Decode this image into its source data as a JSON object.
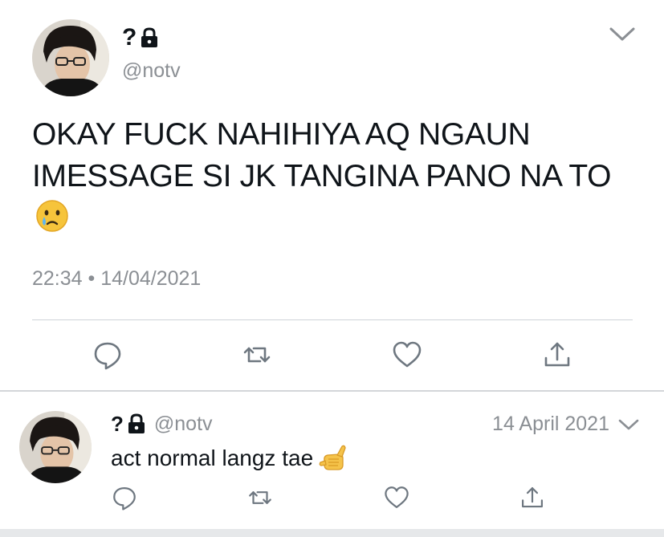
{
  "tweet": {
    "name": "?",
    "handle": "@notv",
    "text": "OKAY FUCK NAHIHIYA AQ NGAUN IMESSAGE SI JK TANGINA PANO NA TO",
    "text_emoji": "crying-face-emoji",
    "meta": "22:34 • 14/04/2021",
    "actions": [
      "reply-icon",
      "retweet-icon",
      "like-icon",
      "share-icon"
    ]
  },
  "reply": {
    "name": "?",
    "handle": "@notv",
    "date": "14 April 2021",
    "text": "act normal langz tae",
    "text_emoji": "call-me-hand-emoji",
    "actions": [
      "reply-icon",
      "retweet-icon",
      "like-icon",
      "share-icon"
    ]
  },
  "colors": {
    "text": "#0f1419",
    "muted": "#8b8f94",
    "divider": "#cfd4d8",
    "icon": "#6e7780"
  }
}
